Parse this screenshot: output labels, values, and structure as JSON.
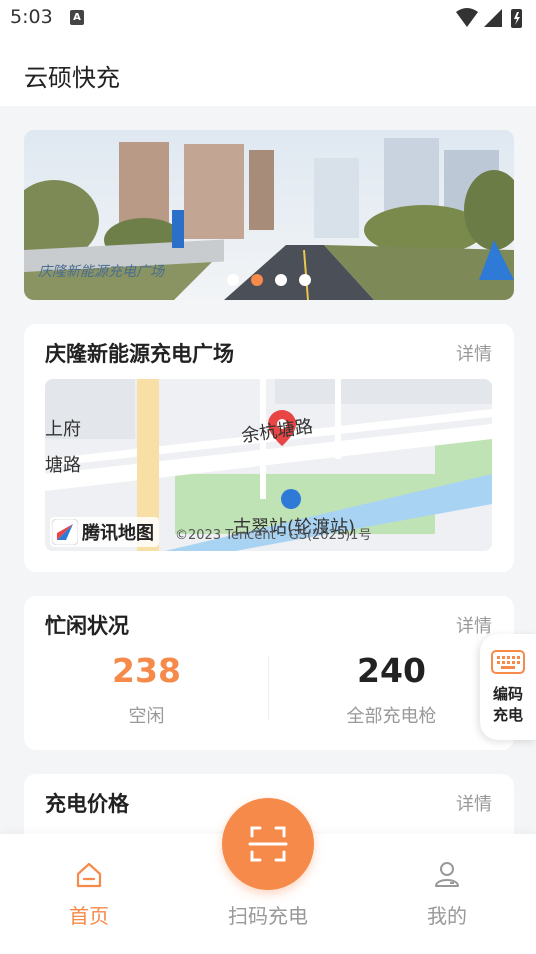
{
  "status": {
    "time": "5:03",
    "a_badge": "A"
  },
  "app": {
    "title": "云硕快充"
  },
  "banner": {
    "slides": 4,
    "active_slide": 1
  },
  "station": {
    "name": "庆隆新能源充电广场",
    "more": "详情",
    "map": {
      "labels": [
        "上府",
        "余杭塘路",
        "塘路",
        "古翠站(轮渡站)"
      ],
      "logo_text": "腾讯地图",
      "copyright": "©2023 Tencent - GS(2023)1号"
    }
  },
  "busy": {
    "title": "忙闲状况",
    "more": "详情",
    "idle_value": "238",
    "idle_label": "空闲",
    "total_value": "240",
    "total_label": "全部充电枪"
  },
  "price": {
    "title": "充电价格",
    "more": "详情"
  },
  "floating": {
    "label": "编码充电"
  },
  "tabs": {
    "home": "首页",
    "scan": "扫码充电",
    "mine": "我的"
  },
  "colors": {
    "accent": "#f58a4a",
    "muted": "#999999"
  }
}
